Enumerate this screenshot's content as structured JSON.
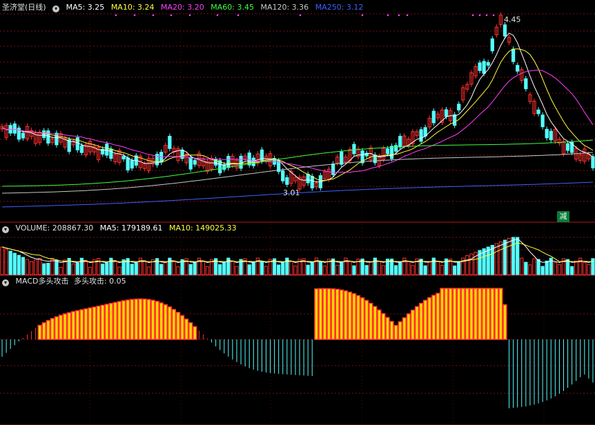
{
  "header_price": {
    "stock": "圣济堂(日线)",
    "ma5": "MA5: 3.25",
    "ma10": "MA10: 3.24",
    "ma20": "MA20: 3.20",
    "ma60": "MA60: 3.45",
    "ma120": "MA120: 3.36",
    "ma250": "MA250: 3.12"
  },
  "header_volume": {
    "volume": "VOLUME: 208867.30",
    "ma5": "MA5: 179189.61",
    "ma10": "MA10: 149025.33"
  },
  "header_macd": {
    "title": "MACD多头攻击",
    "value": "多头攻击: 0.05"
  },
  "annotations": {
    "high": "4.45",
    "low": "3.01",
    "badge": "减"
  },
  "colors": {
    "up": "#ff3030",
    "down": "#54ffff",
    "ma5": "#ffffff",
    "ma10": "#ffff40",
    "ma20": "#ff40ff",
    "ma60": "#40ff40",
    "ma120": "#c8c8c8",
    "ma250": "#4060ff",
    "macd_up_fill": "#ffd700"
  }
}
